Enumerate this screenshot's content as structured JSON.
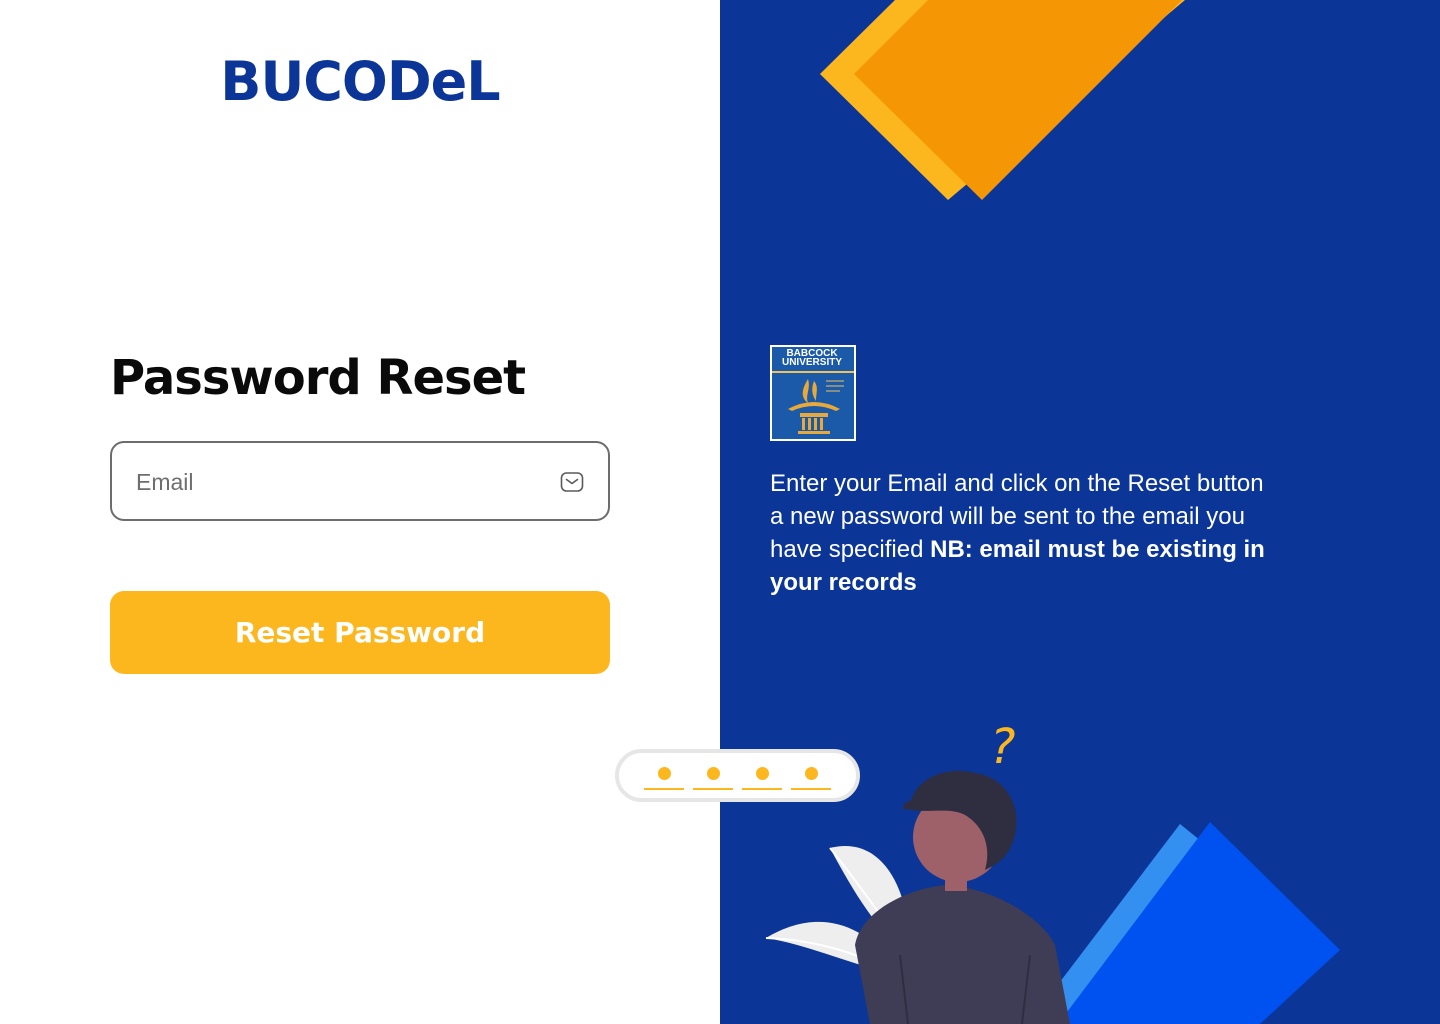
{
  "brand": {
    "name": "BUCODeL"
  },
  "form": {
    "title": "Password Reset",
    "email_placeholder": "Email",
    "email_value": "",
    "submit_label": "Reset Password"
  },
  "info": {
    "logo_text_line1": "BABCOCK",
    "logo_text_line2": "UNIVERSITY",
    "message_regular": "Enter your Email and click on the Reset button a new password will be sent to the email you have specified ",
    "message_bold": "NB: email must be existing in your records"
  },
  "icons": {
    "email_field_icon": "mail-icon",
    "illustration_mark": "question-mark-icon"
  },
  "colors": {
    "brand_blue": "#0b3596",
    "accent_yellow": "#fdb71e",
    "accent_orange": "#f59605",
    "accent_blue": "#0052f0",
    "light_blue": "#3390f0",
    "text_dark": "#0a0a0a"
  }
}
